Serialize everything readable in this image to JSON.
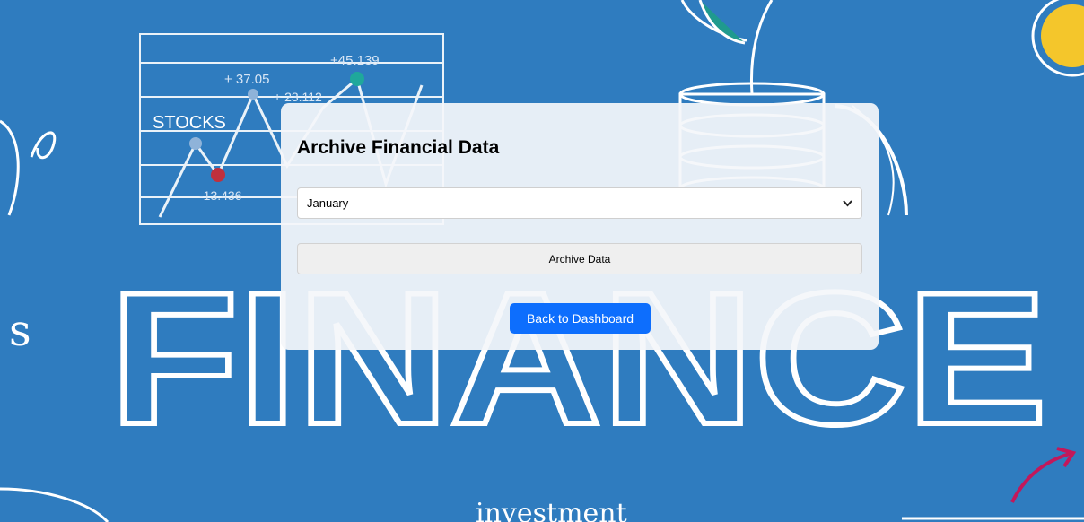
{
  "background": {
    "headline": "FINANCE",
    "chart_label": "STOCKS",
    "chart_annotations": [
      "+ 37.05",
      "+45.139",
      "+ 23.112",
      "-13.436"
    ],
    "bottom_word": "investment"
  },
  "card": {
    "title": "Archive Financial Data",
    "month_select": {
      "value": "January"
    },
    "archive_button": "Archive Data",
    "back_button": "Back to Dashboard"
  },
  "colors": {
    "background_blue": "#2f7cbf",
    "primary_button": "#0d6efd",
    "card_bg": "#f4f6fa"
  }
}
